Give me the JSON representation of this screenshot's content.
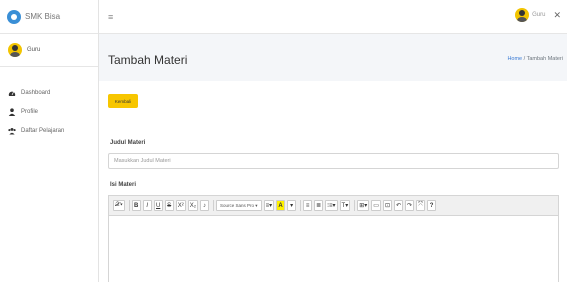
{
  "brand": {
    "name": "SMK Bisa"
  },
  "user": {
    "name": "Guru"
  },
  "sidebar": {
    "items": [
      {
        "label": "Dashboard",
        "icon": "dashboard-icon"
      },
      {
        "label": "Profile",
        "icon": "user-icon"
      },
      {
        "label": "Daftar Pelajaran",
        "icon": "users-icon"
      }
    ]
  },
  "topbar": {
    "user_name": "Guru",
    "close": "✕",
    "menu": "≡"
  },
  "page": {
    "title": "Tambah Materi",
    "breadcrumb": {
      "home": "Home",
      "separator": "/",
      "current": "Tambah Materi"
    }
  },
  "form": {
    "back_button": "Kembali",
    "judul_label": "Judul Materi",
    "judul_placeholder": "Masukkan Judul Materi",
    "isi_label": "Isi Materi"
  },
  "toolbar": {
    "buttons": [
      "𝒳▾",
      "B",
      "I",
      "U",
      "S",
      "X²",
      "X₂",
      "♪",
      "Source Sans Pro ▾",
      "≡▾",
      "A",
      "▾",
      "≡",
      "≣",
      "⁝≡▾",
      "T▾",
      "⊞▾",
      "▭",
      "⊡",
      "↶",
      "↷",
      "⤧",
      "?"
    ]
  }
}
